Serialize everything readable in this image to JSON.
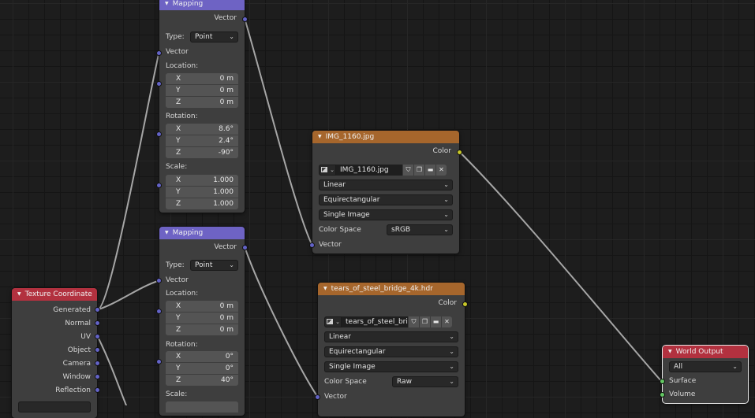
{
  "nodes": {
    "mapping1": {
      "title": "Mapping",
      "out_vector": "Vector",
      "type_label": "Type:",
      "type_value": "Point",
      "in_vector": "Vector",
      "location_label": "Location:",
      "location": [
        {
          "axis": "X",
          "value": "0 m"
        },
        {
          "axis": "Y",
          "value": "0 m"
        },
        {
          "axis": "Z",
          "value": "0 m"
        }
      ],
      "rotation_label": "Rotation:",
      "rotation": [
        {
          "axis": "X",
          "value": "8.6°"
        },
        {
          "axis": "Y",
          "value": "2.4°"
        },
        {
          "axis": "Z",
          "value": "-90°"
        }
      ],
      "scale_label": "Scale:",
      "scale": [
        {
          "axis": "X",
          "value": "1.000"
        },
        {
          "axis": "Y",
          "value": "1.000"
        },
        {
          "axis": "Z",
          "value": "1.000"
        }
      ]
    },
    "mapping2": {
      "title": "Mapping",
      "out_vector": "Vector",
      "type_label": "Type:",
      "type_value": "Point",
      "in_vector": "Vector",
      "location_label": "Location:",
      "location": [
        {
          "axis": "X",
          "value": "0 m"
        },
        {
          "axis": "Y",
          "value": "0 m"
        },
        {
          "axis": "Z",
          "value": "0 m"
        }
      ],
      "rotation_label": "Rotation:",
      "rotation": [
        {
          "axis": "X",
          "value": "0°"
        },
        {
          "axis": "Y",
          "value": "0°"
        },
        {
          "axis": "Z",
          "value": "40°"
        }
      ],
      "scale_label": "Scale:"
    },
    "image1": {
      "title": "IMG_1160.jpg",
      "out_color": "Color",
      "image_name": "IMG_1160.jpg",
      "interpolation": "Linear",
      "projection": "Equirectangular",
      "source": "Single Image",
      "colorspace_label": "Color Space",
      "colorspace_value": "sRGB",
      "in_vector": "Vector"
    },
    "image2": {
      "title": "tears_of_steel_bridge_4k.hdr",
      "out_color": "Color",
      "image_name": "tears_of_steel_bri...",
      "interpolation": "Linear",
      "projection": "Equirectangular",
      "source": "Single Image",
      "colorspace_label": "Color Space",
      "colorspace_value": "Raw",
      "in_vector": "Vector"
    },
    "texcoord": {
      "title": "Texture Coordinate",
      "outputs": [
        "Generated",
        "Normal",
        "UV",
        "Object",
        "Camera",
        "Window",
        "Reflection"
      ]
    },
    "world_output": {
      "title": "World Output",
      "target": "All",
      "in_surface": "Surface",
      "in_volume": "Volume"
    }
  },
  "colors": {
    "canvas": "#1d1d1d",
    "node_body": "#3e3e3e",
    "vector_header": "#6e63c4",
    "texture_header": "#a6662c",
    "output_header": "#b2313f",
    "vector_socket": "#6363c7",
    "color_socket": "#c7c729",
    "shader_socket": "#63c763",
    "link": "#a6a6a6"
  },
  "icons": [
    "collapse-triangle-icon",
    "image-browse-icon",
    "chevron-down-icon",
    "fake-user-shield-icon",
    "duplicate-icon",
    "folder-icon",
    "close-icon"
  ]
}
